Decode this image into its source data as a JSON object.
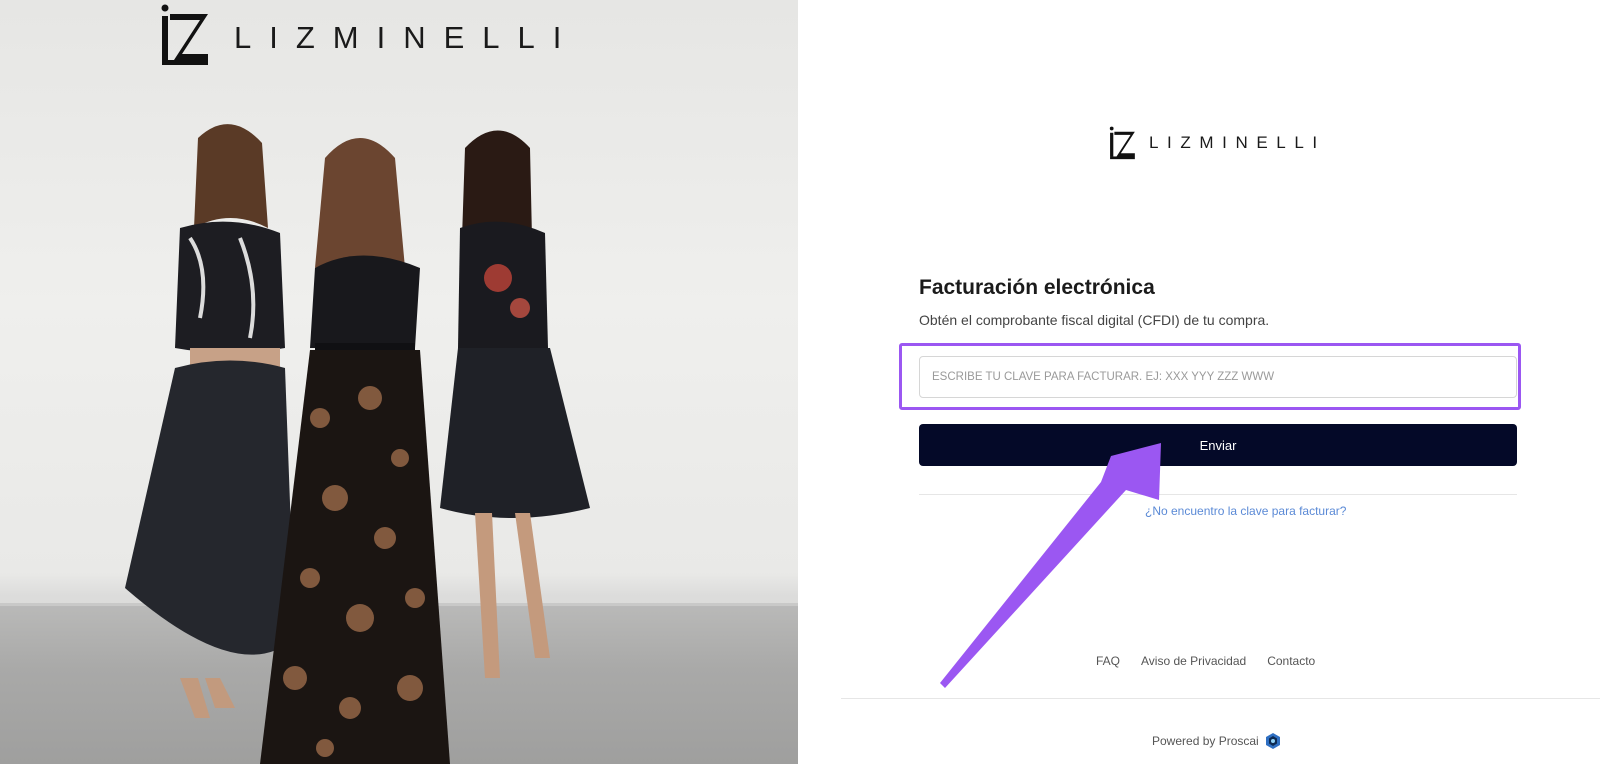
{
  "hero": {
    "logo_text": "LIZMINELLI"
  },
  "form": {
    "brand_text": "LIZMINELLI",
    "title": "Facturación electrónica",
    "subtitle": "Obtén el comprobante fiscal digital (CFDI) de tu compra.",
    "input_placeholder": "ESCRIBE TU CLAVE PARA FACTURAR. EJ: XXX YYY ZZZ WWW",
    "input_value": "",
    "submit_label": "Enviar",
    "help_link": "¿No encuentro la clave para facturar?"
  },
  "footer": {
    "links": [
      "FAQ",
      "Aviso de Privacidad",
      "Contacto"
    ],
    "powered_by": "Powered by Proscai"
  },
  "colors": {
    "highlight": "#9b57f2",
    "button": "#040928",
    "link": "#5b8ad6",
    "arrow": "#9b57f2"
  }
}
